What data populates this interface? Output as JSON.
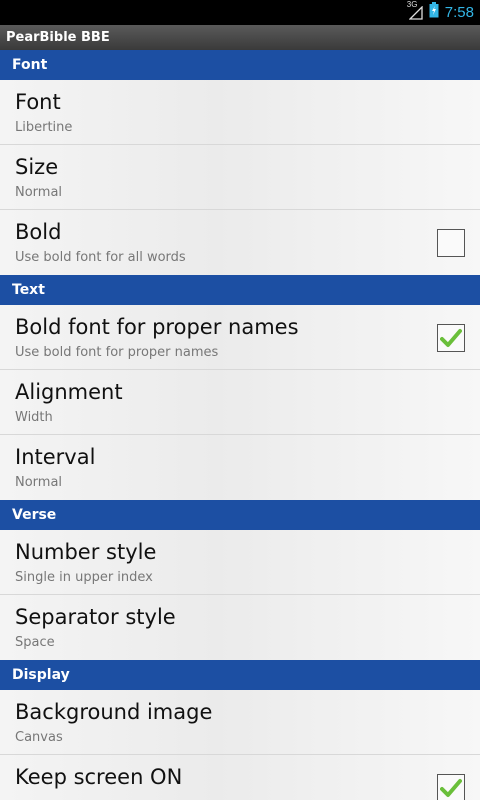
{
  "status_bar": {
    "network": "3G",
    "time": "7:58"
  },
  "app": {
    "title": "PearBible BBE"
  },
  "sections": {
    "font": {
      "header": "Font",
      "items": [
        {
          "title": "Font",
          "summary": "Libertine"
        },
        {
          "title": "Size",
          "summary": "Normal"
        },
        {
          "title": "Bold",
          "summary": "Use bold font for all words",
          "checked": false
        }
      ]
    },
    "text": {
      "header": "Text",
      "items": [
        {
          "title": "Bold font for proper names",
          "summary": "Use bold font for proper names",
          "checked": true
        },
        {
          "title": "Alignment",
          "summary": "Width"
        },
        {
          "title": "Interval",
          "summary": "Normal"
        }
      ]
    },
    "verse": {
      "header": "Verse",
      "items": [
        {
          "title": "Number style",
          "summary": "Single in upper index"
        },
        {
          "title": "Separator style",
          "summary": "Space"
        }
      ]
    },
    "display": {
      "header": "Display",
      "items": [
        {
          "title": "Background image",
          "summary": "Canvas"
        },
        {
          "title": "Keep screen ON",
          "checked": true
        }
      ]
    }
  },
  "colors": {
    "section_header": "#1c4fa3",
    "accent": "#33b5e5",
    "check": "#6abf3a"
  }
}
